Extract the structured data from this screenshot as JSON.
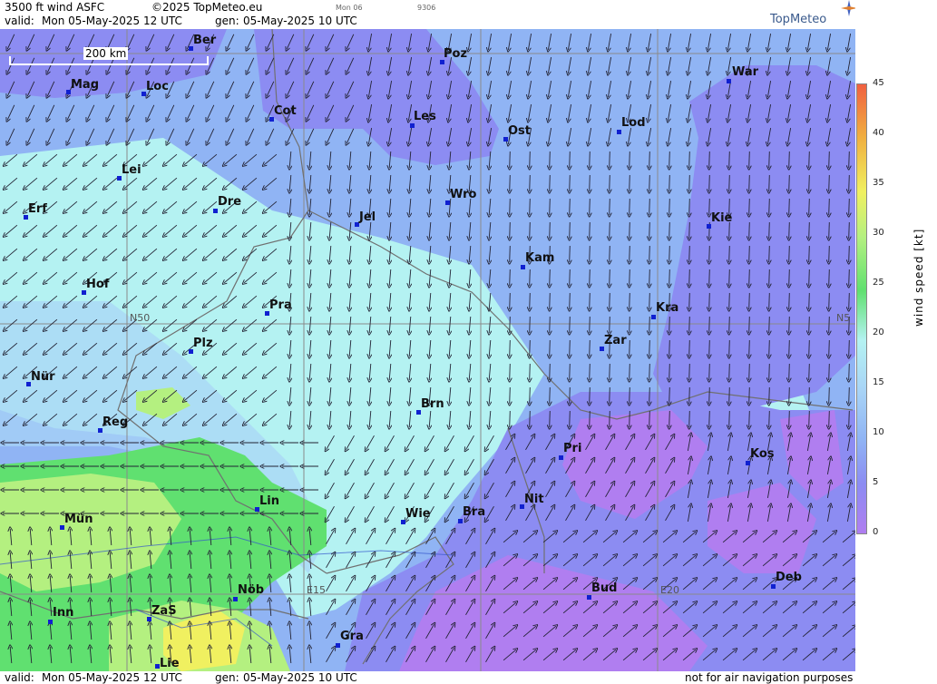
{
  "header": {
    "title": "3500 ft wind ASFC",
    "copyright": "©2025 TopMeteo.eu",
    "valid_label": "valid:",
    "valid_value": "Mon  05-May-2025  12 UTC",
    "gen_label": "gen:",
    "gen_value": "05-May-2025 10 UTC",
    "tiny1": "Mon 06",
    "tiny2": "9306"
  },
  "logo": "TopMeteo",
  "footer": {
    "valid_label": "valid:",
    "valid_value": "Mon  05-May-2025  12 UTC",
    "gen_label": "gen:",
    "gen_value": "05-May-2025 10 UTC",
    "disclaimer": "not for air navigation purposes"
  },
  "legend": {
    "title": "wind  speed  [kt]",
    "ticks": [
      "45",
      "40",
      "35",
      "30",
      "25",
      "20",
      "15",
      "10",
      "5",
      "0"
    ]
  },
  "scale_bar": "200 km",
  "grid_labels": {
    "n50": "N50",
    "n50_right": "N5",
    "e15": "E15",
    "e20": "E20"
  },
  "cities": [
    "Ber",
    "Poz",
    "War",
    "Mag",
    "Loc",
    "Cot",
    "Les",
    "Ost",
    "Lod",
    "Lei",
    "Erf",
    "Dre",
    "Jel",
    "Wro",
    "Kie",
    "Kam",
    "Hof",
    "Pra",
    "Kra",
    "Zar",
    "Plz",
    "Nür",
    "Brn",
    "Reg",
    "Kos",
    "Pri",
    "Lin",
    "Mün",
    "Wie",
    "Bra",
    "Nit",
    "Deb",
    "Inn",
    "Nöb",
    "Bud",
    "ZaS",
    "Gra",
    "Lie"
  ],
  "colors": {
    "purple": "#b07ef0",
    "violet": "#8c8cf2",
    "blue": "#90b4f4",
    "lightblue": "#a8d4f6",
    "cyan": "#b4f2f2",
    "green": "#60e070",
    "lime": "#b4f080",
    "yellow": "#f0f060"
  }
}
